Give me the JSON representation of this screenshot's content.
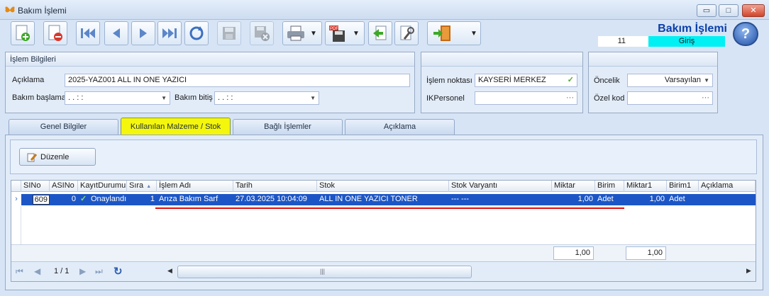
{
  "window": {
    "title": "Bakım İşlemi",
    "min_glyph": "▭",
    "max_glyph": "□",
    "close_glyph": "✕"
  },
  "header": {
    "title": "Bakım İşlemi",
    "record_no": "11",
    "status": "Giriş",
    "help_glyph": "?"
  },
  "toolbar": {
    "icons": [
      "new-icon",
      "delete-icon",
      "first-record-icon",
      "previous-record-icon",
      "next-record-icon",
      "last-record-icon",
      "refresh-icon",
      "save-icon",
      "save-close-icon",
      "print-icon",
      "export-pdf-icon",
      "import-icon",
      "tools-icon",
      "exit-icon"
    ]
  },
  "info_panel": {
    "title": "İşlem Bilgileri",
    "aciklama_label": "Açıklama",
    "aciklama_value": "2025-YAZ001 ALL IN ONE YAZICI",
    "bakim_baslama_label": "Bakım başlama",
    "bakim_baslama_value": ". .     :  :",
    "bakim_bitis_label": "Bakım bitiş",
    "bakim_bitis_value": ". .     :  :"
  },
  "mid_panel": {
    "islem_noktasi_label": "İşlem noktası",
    "islem_noktasi_value": "KAYSERİ MERKEZ",
    "ikpersonel_label": "IKPersonel",
    "ikpersonel_value": "",
    "ellipsis": "···"
  },
  "right_panel": {
    "oncelik_label": "Öncelik",
    "oncelik_value": "Varsayılan",
    "ozel_kod_label": "Özel kod",
    "ozel_kod_value": ""
  },
  "tabs": [
    "Genel Bilgiler",
    "Kullanılan Malzeme / Stok",
    "Bağlı İşlemler",
    "Açıklama"
  ],
  "edit_button": "Düzenle",
  "grid": {
    "columns": [
      "SINo",
      "ASINo",
      "KayıtDurumu",
      "Sıra",
      "İşlem Adı",
      "Tarih",
      "Stok",
      "Stok Varyantı",
      "Miktar",
      "Birim",
      "Miktar1",
      "Birim1",
      "Açıklama"
    ],
    "rows": [
      {
        "sino": "609",
        "asino": "0",
        "durum": "Onaylandı",
        "sira": "1",
        "islem_adi": "Arıza Bakım Sarf",
        "tarih": "27.03.2025 10:04:09",
        "stok": "ALL IN ONE YAZICI TONER",
        "varyant": "--- ---",
        "miktar": "1,00",
        "birim": "Adet",
        "miktar1": "1,00",
        "birim1": "Adet",
        "aciklama": ""
      }
    ],
    "footer": {
      "miktar_total": "1,00",
      "miktar1_total": "1,00"
    },
    "pager": {
      "text": "1 / 1"
    }
  },
  "colors": {
    "accent": "#0b3fa8",
    "selection": "#1c56c6",
    "active_tab": "#f4f60c",
    "status_cyan": "#00f0f4",
    "underline": "#e01010"
  }
}
